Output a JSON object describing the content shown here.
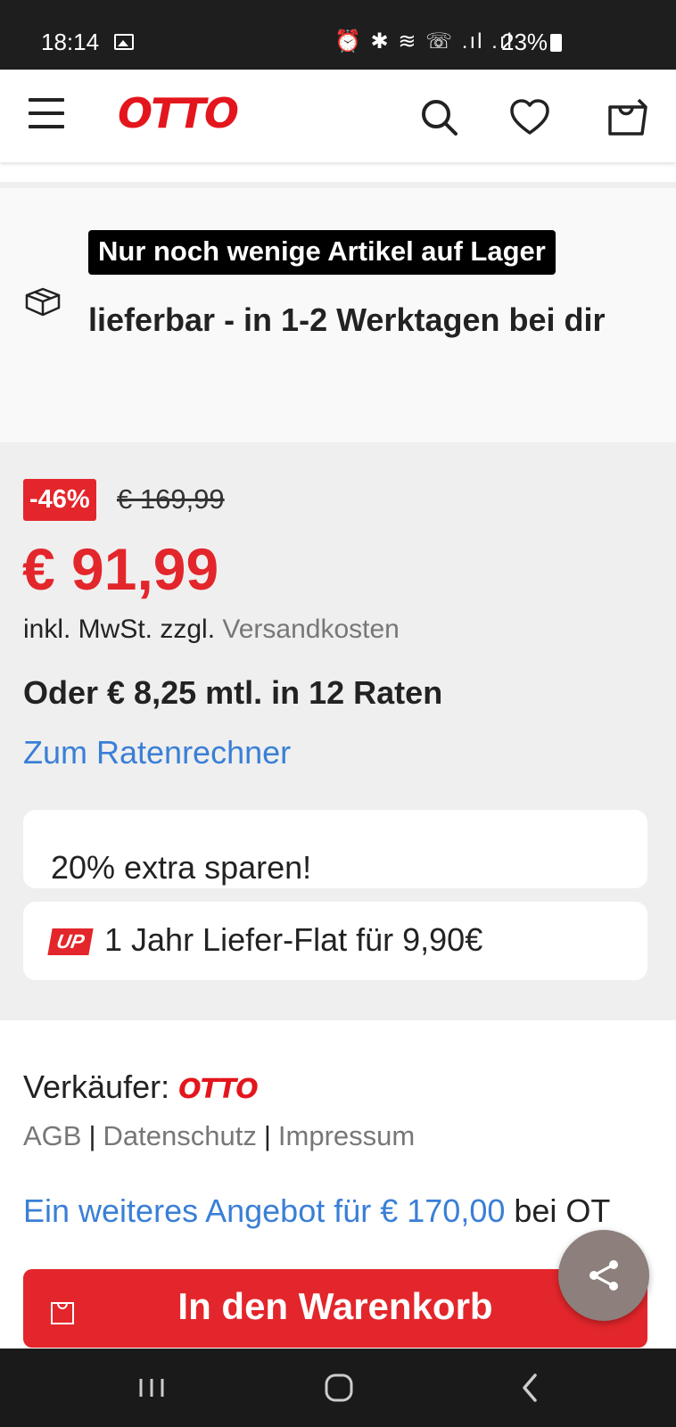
{
  "status_bar": {
    "time": "18:14",
    "system_icons": "⏰ ✱ ≋ ☏ .ıl .ıl",
    "battery": "23%"
  },
  "header": {
    "logo": "OTTO",
    "icons": [
      "menu-icon",
      "search-icon",
      "heart-icon",
      "shopping-bag-icon"
    ]
  },
  "availability": {
    "stock_badge": "Nur noch wenige Artikel auf Lager",
    "delivery": "lieferbar - in 1-2 Werktagen bei dir"
  },
  "pricing": {
    "discount": "-46%",
    "old_price": "€ 169,99",
    "price": "€ 91,99",
    "tax_prefix": "inkl. MwSt. zzgl.",
    "tax_link": "Versandkosten",
    "installments": "Oder € 8,25 mtl. in 12 Raten",
    "rate_calculator_link": "Zum Ratenrechner"
  },
  "promos": {
    "extra_savings": "20% extra sparen!",
    "up_badge": "UP",
    "flat": "1 Jahr Liefer-Flat für 9,90€"
  },
  "seller": {
    "label": "Verkäufer:",
    "logo": "OTTO",
    "links": [
      "AGB",
      "Datenschutz",
      "Impressum"
    ]
  },
  "offer": {
    "link": "Ein weiteres Angebot für € 170,00",
    "rest": "bei OT"
  },
  "cart_button": {
    "label": "In den Warenkorb"
  },
  "colors": {
    "brand_red": "#e3262b",
    "link_blue": "#3a7fd6",
    "fab_gray": "#8d7f7b"
  }
}
